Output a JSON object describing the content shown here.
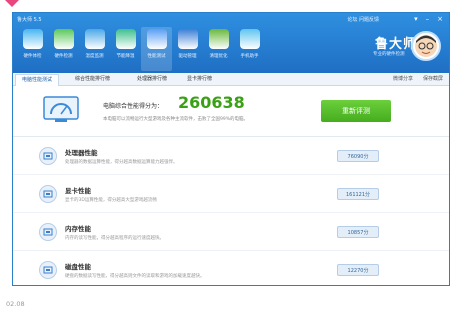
{
  "window": {
    "app_title": "鲁大师 5.5",
    "top_links": "论坛   问题反馈",
    "controls": [
      "▾",
      "–",
      "×"
    ]
  },
  "toolbar": [
    {
      "icon": "monitor-icon",
      "label": "硬件体检",
      "color": "#46b6f0"
    },
    {
      "icon": "chip-icon",
      "label": "硬件检测",
      "color": "#5ac85a"
    },
    {
      "icon": "thermometer-icon",
      "label": "温度监测",
      "color": "#4aa8e8"
    },
    {
      "icon": "leaf-icon",
      "label": "节能降温",
      "color": "#3cc08c"
    },
    {
      "icon": "gauge-icon",
      "label": "性能测试",
      "color": "#5a9ef5"
    },
    {
      "icon": "driver-icon",
      "label": "驱动管理",
      "color": "#3b7fd6"
    },
    {
      "icon": "broom-icon",
      "label": "清理优化",
      "color": "#69b83a"
    },
    {
      "icon": "phone-icon",
      "label": "手机助手",
      "color": "#5fc5f0"
    }
  ],
  "brand": {
    "name": "鲁大师",
    "slogan": "专业的硬件检测"
  },
  "tabs": [
    "电脑性能测试",
    "综合性能排行榜",
    "处理器排行榜",
    "显卡排行榜"
  ],
  "tab_actions": [
    "微博分享",
    "保存截屏"
  ],
  "hero": {
    "label": "电脑综合性能得分为：",
    "score": "260638",
    "sub": "本电脑可以流畅运行大型游戏及各种主流软件，击败了全国99%的电脑。",
    "button": "重新评测"
  },
  "rows": [
    {
      "icon": "cpu-icon",
      "title": "处理器性能",
      "desc": "处理器的数据运算性能，得分越高数据运算能力越强悍。",
      "score": "76090分"
    },
    {
      "icon": "graphics-card-icon",
      "title": "显卡性能",
      "desc": "显卡的3D运算性能，得分越高大型游戏越流畅",
      "score": "161121分"
    },
    {
      "icon": "memory-icon",
      "title": "内存性能",
      "desc": "内存的读写性能，得分越高程序的运行速度越快。",
      "score": "10857分"
    },
    {
      "icon": "disk-icon",
      "title": "磁盘性能",
      "desc": "硬盘的数据读写性能，得分越高则文件的读取和游戏的加载速度越快。",
      "score": "12270分"
    }
  ],
  "caption": "02.08"
}
